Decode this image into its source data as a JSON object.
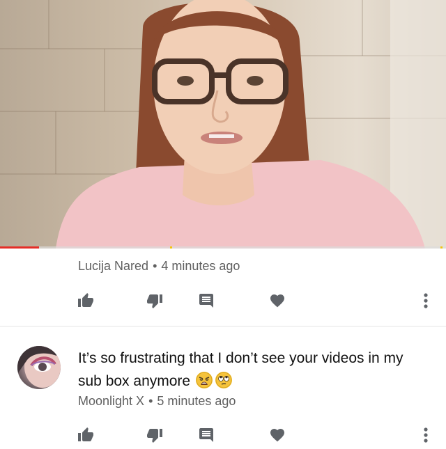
{
  "video": {
    "progress_fraction": 0.087,
    "colors": {
      "played": "#e52d27",
      "ad_marker": "#f2c40e"
    }
  },
  "comments": [
    {
      "author": "Lucija Nared",
      "separator": "•",
      "time": "4 minutes ago",
      "actions": [
        "like-icon",
        "dislike-icon",
        "reply-icon",
        "heart-icon",
        "more-icon"
      ]
    },
    {
      "text": "It’s so frustrating that I don’t see your videos in my sub box anymore",
      "emojis": [
        "weary-face-emoji",
        "face-with-rolling-eyes-emoji"
      ],
      "author": "Moonlight X",
      "separator": "•",
      "time": "5 minutes ago",
      "actions": [
        "like-icon",
        "dislike-icon",
        "reply-icon",
        "heart-icon",
        "more-icon"
      ]
    }
  ],
  "colors": {
    "icon": "#5f6368",
    "meta_text": "#606060",
    "body_text": "#111111"
  }
}
